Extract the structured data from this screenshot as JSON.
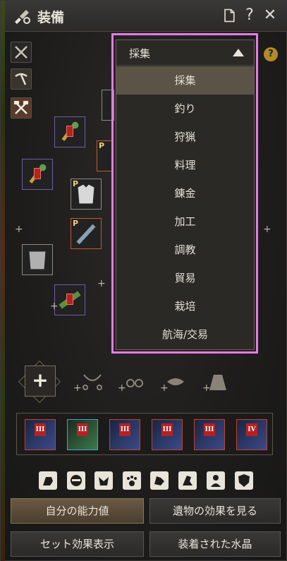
{
  "window": {
    "title": "装備"
  },
  "titlebar": {
    "doc_icon": "document-icon",
    "help_label": "?",
    "close_label": "✕"
  },
  "sidebar": {
    "items": [
      {
        "icon": "crossed-swords-icon"
      },
      {
        "icon": "pickaxe-icon"
      },
      {
        "icon": "crossed-tools-icon"
      }
    ]
  },
  "dropdown": {
    "selected": "採集",
    "options": [
      "採集",
      "釣り",
      "狩猟",
      "料理",
      "錬金",
      "加工",
      "調教",
      "貿易",
      "栽培",
      "航海/交易"
    ],
    "selected_index": 0
  },
  "help_right": "?",
  "slot_badges": {
    "p_label": "P"
  },
  "crystals": [
    "III",
    "III",
    "III",
    "III",
    "III",
    "IV"
  ],
  "accessory_row": {
    "main_plus": "+"
  },
  "pet_icons": [
    "pet-lion-icon",
    "pet-ninja-icon",
    "pet-armor-icon",
    "pet-paw-icon",
    "pet-dog-icon",
    "pet-horse-icon",
    "pet-person-icon",
    "pet-shield-icon"
  ],
  "buttons": {
    "my_stats": "自分の能力値",
    "view_artifacts": "遺物の効果を見る",
    "set_effects": "セット効果表示",
    "equipped_crystals": "装着された水晶"
  },
  "colors": {
    "highlight_outline": "#e67be6",
    "selected_row": "#5a5346",
    "accent_gold": "#b38a2a"
  }
}
